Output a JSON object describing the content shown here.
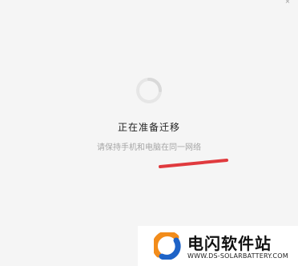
{
  "window": {
    "close_glyph": "×"
  },
  "migration": {
    "title": "正在准备迁移",
    "subtitle": "请保持手机和电脑在同一网络"
  },
  "watermark": {
    "brand": "电闪软件站",
    "url": "WWW.DS-SOLARBATTERY.COM"
  },
  "colors": {
    "background": "#f5f5f5",
    "spinner": "#e6e6e6",
    "annotation_stroke": "#e03a3e",
    "watermark_orange": "#f28c1b",
    "watermark_blue": "#1e63c7"
  }
}
